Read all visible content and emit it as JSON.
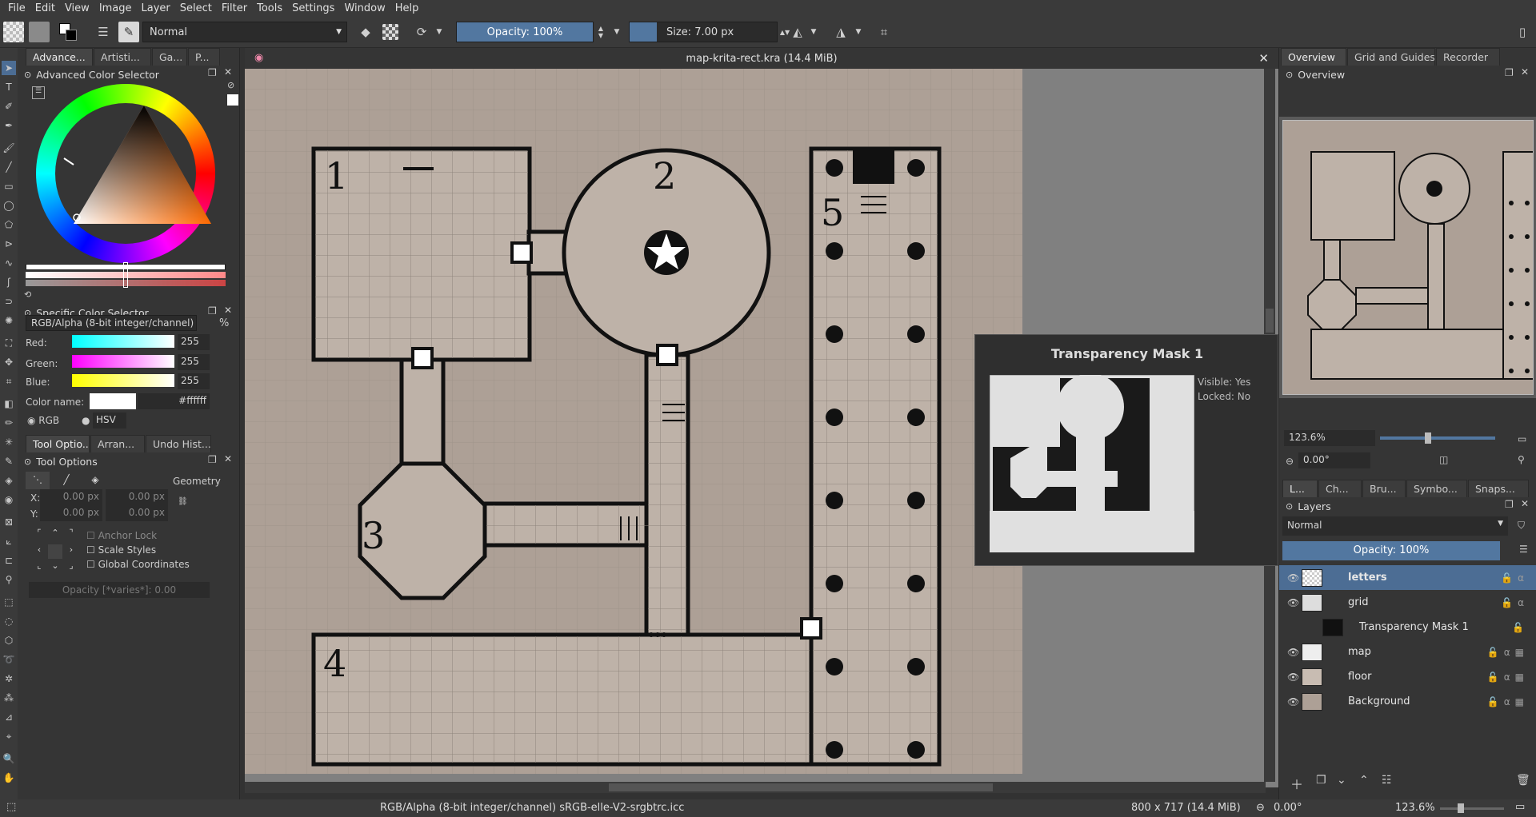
{
  "menu": [
    "File",
    "Edit",
    "View",
    "Image",
    "Layer",
    "Select",
    "Filter",
    "Tools",
    "Settings",
    "Window",
    "Help"
  ],
  "toolbar": {
    "blend_mode": "Normal",
    "opacity": "Opacity: 100%",
    "size": "Size: 7.00 px"
  },
  "left_tabs": [
    "Advance...",
    "Artisti...",
    "Ga...",
    "P..."
  ],
  "advanced_color_selector": {
    "title": "Advanced Color Selector"
  },
  "specific_color_selector": {
    "title": "Specific Color Selector",
    "model": "RGB/Alpha (8-bit integer/channel)",
    "percent_label": "%",
    "channels": [
      {
        "label": "Red:",
        "value": "255"
      },
      {
        "label": "Green:",
        "value": "255"
      },
      {
        "label": "Blue:",
        "value": "255"
      }
    ],
    "color_name_label": "Color name:",
    "hex": "#ffffff",
    "rgb_label": "RGB",
    "hsv_label": "HSV"
  },
  "tool_tabs": [
    "Tool Optio...",
    "Arran...",
    "Undo Hist..."
  ],
  "tool_options": {
    "title": "Tool Options",
    "section": "Geometry",
    "x_label": "X:",
    "y_label": "Y:",
    "x1": "0.00 px",
    "x2": "0.00 px",
    "y1": "0.00 px",
    "y2": "0.00 px",
    "anchor_lock": "Anchor Lock",
    "scale_styles": "Scale Styles",
    "global_coords": "Global Coordinates",
    "opacity": "Opacity [*varies*]: 0.00"
  },
  "document": {
    "title": "map-krita-rect.kra (14.4 MiB)"
  },
  "map": {
    "room_labels": [
      "1",
      "2",
      "3",
      "4",
      "5"
    ]
  },
  "right_tabs": [
    "Overview",
    "Grid and Guides",
    "Recorder"
  ],
  "overview": {
    "title": "Overview",
    "zoom": "123.6%",
    "rotation": "0.00°"
  },
  "dock_tabs": [
    "L...",
    "Ch...",
    "Bru...",
    "Symbo...",
    "Snaps..."
  ],
  "layers": {
    "title": "Layers",
    "blend": "Normal",
    "opacity": "Opacity:  100%",
    "items": [
      {
        "name": "letters",
        "selected": true
      },
      {
        "name": "grid"
      },
      {
        "name": "Transparency Mask 1"
      },
      {
        "name": "map"
      },
      {
        "name": "floor"
      },
      {
        "name": "Background"
      }
    ]
  },
  "tooltip": {
    "title": "Transparency Mask 1",
    "visible": "Visible: Yes",
    "locked": "Locked: No"
  },
  "status": {
    "colorspace": "RGB/Alpha (8-bit integer/channel)  sRGB-elle-V2-srgbtrc.icc",
    "dimensions": "800 x 717 (14.4 MiB)",
    "rotation": "0.00°",
    "zoom": "123.6%"
  }
}
